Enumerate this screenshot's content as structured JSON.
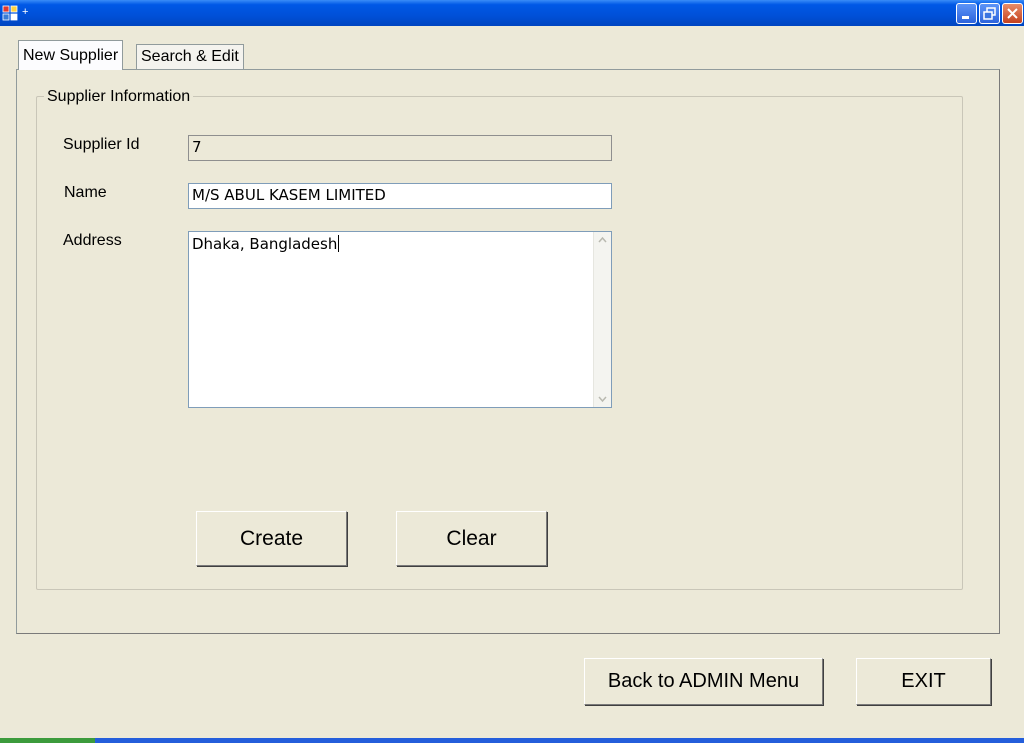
{
  "window": {
    "title": "",
    "title_glyph": "+",
    "icons": [
      "app-icon",
      "minimize-icon",
      "restore-icon",
      "close-icon"
    ]
  },
  "tabs": [
    {
      "label": "New Supplier",
      "active": true
    },
    {
      "label": "Search & Edit",
      "active": false
    }
  ],
  "form": {
    "group_title": "Supplier Information",
    "supplier_id": {
      "label": "Supplier Id",
      "value": "7"
    },
    "name": {
      "label": "Name",
      "value": "M/S ABUL KASEM LIMITED"
    },
    "address": {
      "label": "Address",
      "value": "Dhaka, Bangladesh"
    }
  },
  "buttons": {
    "create": "Create",
    "clear": "Clear",
    "back": "Back to ADMIN Menu",
    "exit": "EXIT"
  },
  "colors": {
    "titlebar": "#0054e3",
    "form_background": "#ece9d8",
    "close_button": "#c4411e"
  }
}
